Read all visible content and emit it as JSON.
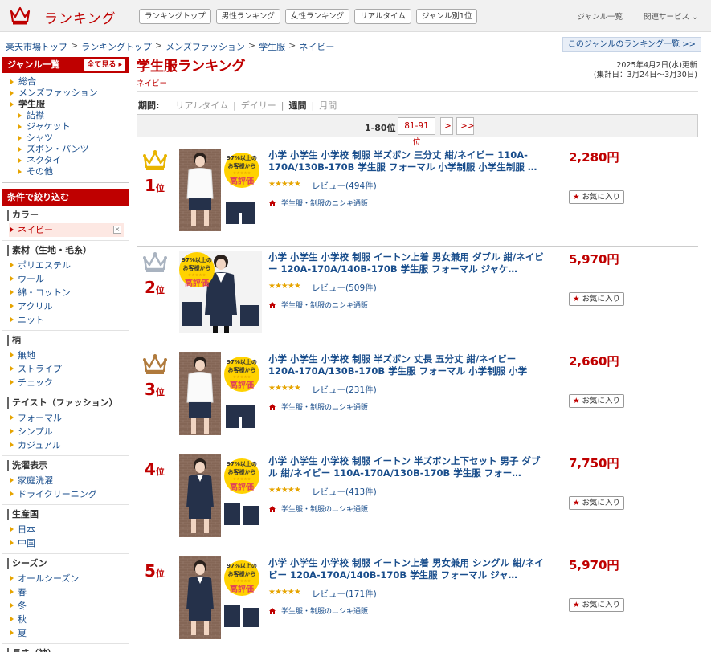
{
  "header": {
    "logo_text": "ランキング",
    "nav": [
      "ランキングトップ",
      "男性ランキング",
      "女性ランキング",
      "リアルタイム",
      "ジャンル別1位"
    ],
    "right_links": [
      "ジャンル一覧",
      "関連サービス ⌄"
    ]
  },
  "breadcrumb": [
    "楽天市場トップ",
    "ランキングトップ",
    "メンズファッション",
    "学生服",
    "ネイビー"
  ],
  "genre_rank_link": "このジャンルのランキング一覧 >>",
  "sidebar": {
    "genre_title": "ジャンル一覧",
    "see_all": "全て見る",
    "genres": [
      {
        "label": "総合",
        "level": 0
      },
      {
        "label": "メンズファッション",
        "level": 0
      },
      {
        "label": "学生服",
        "level": 0,
        "current": true
      },
      {
        "label": "詰襟",
        "level": 1
      },
      {
        "label": "ジャケット",
        "level": 1
      },
      {
        "label": "シャツ",
        "level": 1
      },
      {
        "label": "ズボン・パンツ",
        "level": 1
      },
      {
        "label": "ネクタイ",
        "level": 1
      },
      {
        "label": "その他",
        "level": 1
      }
    ],
    "filter_title": "条件で絞り込む",
    "filters": [
      {
        "title": "カラー",
        "items": [
          "ネイビー"
        ],
        "selected": "ネイビー"
      },
      {
        "title": "素材（生地・毛糸）",
        "items": [
          "ポリエステル",
          "ウール",
          "綿・コットン",
          "アクリル",
          "ニット"
        ]
      },
      {
        "title": "柄",
        "items": [
          "無地",
          "ストライプ",
          "チェック"
        ]
      },
      {
        "title": "テイスト（ファッション）",
        "items": [
          "フォーマル",
          "シンプル",
          "カジュアル"
        ]
      },
      {
        "title": "洗濯表示",
        "items": [
          "家庭洗濯",
          "ドライクリーニング"
        ]
      },
      {
        "title": "生産国",
        "items": [
          "日本",
          "中国"
        ]
      },
      {
        "title": "シーズン",
        "items": [
          "オールシーズン",
          "春",
          "冬",
          "秋",
          "夏"
        ]
      },
      {
        "title": "長さ（袖）",
        "items": []
      }
    ]
  },
  "main": {
    "title": "学生服ランキング",
    "subtitle": "ネイビー",
    "updated": "2025年4月2日(水)更新",
    "period_range": "(集計日：3月24日〜3月30日)",
    "period_label": "期間:",
    "periods": [
      {
        "label": "リアルタイム",
        "active": false
      },
      {
        "label": "デイリー",
        "active": false
      },
      {
        "label": "週間",
        "active": true
      },
      {
        "label": "月間",
        "active": false
      }
    ],
    "pager": {
      "current": "1-80位",
      "next_range": "81-91位",
      "next": ">",
      "last": ">>"
    },
    "fav_label": "お気に入り",
    "rank_unit": "位",
    "items": [
      {
        "rank": "1",
        "crown": "gold",
        "title": "小学 小学生 小学校 制服 半ズボン 三分丈 紺/ネイビー 110A-170A/130B-170B 学生服 フォーマル 小学制服 小学生制服 …",
        "rating": 4.5,
        "review": "レビュー(494件)",
        "shop": "学生服・制服のニシキ通販",
        "price": "2,280円",
        "thumb": "shorts-white-shirt"
      },
      {
        "rank": "2",
        "crown": "silver",
        "title": "小学 小学生 小学校 制服 イートン上着 男女兼用 ダブル 紺/ネイビー 120A-170A/140B-170B 学生服 フォーマル ジャケ…",
        "rating": 4.5,
        "review": "レビュー(509件)",
        "shop": "学生服・制服のニシキ通販",
        "price": "5,970円",
        "thumb": "double-jacket-girl"
      },
      {
        "rank": "3",
        "crown": "bronze",
        "title": "小学 小学生 小学校 制服 半ズボン 丈長 五分丈 紺/ネイビー 120A-170A/130B-170B 学生服 フォーマル 小学制服 小学生…",
        "rating": 4.5,
        "review": "レビュー(231件)",
        "shop": "学生服・制服のニシキ通販",
        "price": "2,660円",
        "thumb": "long-shorts"
      },
      {
        "rank": "4",
        "crown": "",
        "title": "小学 小学生 小学校 制服 イートン 半ズボン上下セット 男子 ダブル 紺/ネイビー 110A-170A/130B-170B 学生服 フォー…",
        "rating": 4.5,
        "review": "レビュー(413件)",
        "shop": "学生服・制服のニシキ通販",
        "price": "7,750円",
        "thumb": "double-set-boy"
      },
      {
        "rank": "5",
        "crown": "",
        "title": "小学 小学生 小学校 制服 イートン上着 男女兼用 シングル 紺/ネイビー 120A-170A/140B-170B 学生服 フォーマル ジャ…",
        "rating": 4.5,
        "review": "レビュー(171件)",
        "shop": "学生服・制服のニシキ通販",
        "price": "5,970円",
        "thumb": "single-jacket-boy"
      }
    ],
    "badge": {
      "line1": "97%以上の",
      "line2": "お客様から",
      "line3": "高評価",
      "stars": "★★★★★"
    }
  },
  "colors": {
    "brand": "#bf0000",
    "link": "#1a4e8c",
    "star": "#e6a400",
    "gold": "#e8b400",
    "silver": "#a9b3c0",
    "bronze": "#b07a3c"
  }
}
